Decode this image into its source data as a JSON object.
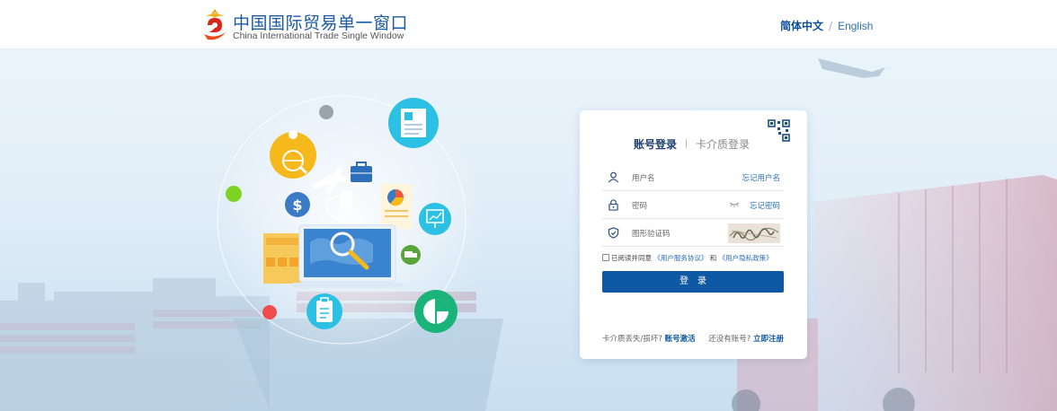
{
  "header": {
    "brand_cn": "中国国际贸易单一窗口",
    "brand_en": "China International Trade Single Window",
    "lang_cn": "简体中文",
    "lang_sep": "/",
    "lang_en": "English"
  },
  "login": {
    "tab_account": "账号登录",
    "tab_card": "卡介质登录",
    "username_placeholder": "用户名",
    "forgot_username": "忘记用户名",
    "password_placeholder": "密码",
    "forgot_password": "忘记密码",
    "captcha_placeholder": "图形验证码",
    "agree_prefix": "已阅读并同意",
    "agree_service": "《用户服务协议》",
    "agree_and": "和",
    "agree_privacy": "《用户隐私政策》",
    "login_button": "登录",
    "card_lost_text": "卡介质丢失/损坏?",
    "account_activate": "账号激活",
    "no_account_text": "还没有账号?",
    "register_now": "立即注册"
  },
  "colors": {
    "brand_blue": "#0f58a3",
    "link_blue": "#2c6fb7"
  }
}
